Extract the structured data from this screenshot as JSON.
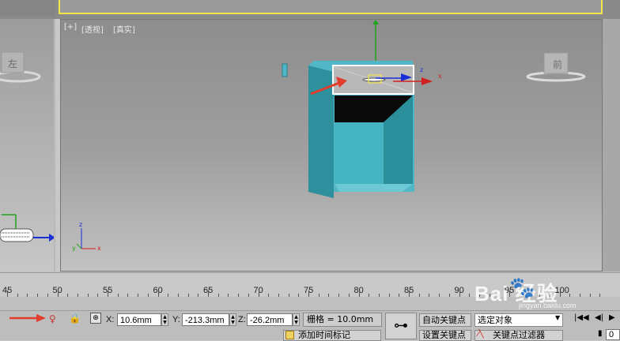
{
  "viewport": {
    "label_plus": "[+]",
    "label_view": "[透视]",
    "label_mode": "[真实]",
    "viewcube_left_face": "左",
    "viewcube_right_face": "前",
    "gizmo_x": "x",
    "gizmo_y": "y",
    "gizmo_z": "z"
  },
  "timeline": {
    "ticks": [
      "45",
      "50",
      "55",
      "60",
      "65",
      "70",
      "75",
      "80",
      "85",
      "90",
      "95",
      "100"
    ]
  },
  "status": {
    "x_label": "X:",
    "x_value": "10.6mm",
    "y_label": "Y:",
    "y_value": "-213.3mm",
    "z_label": "Z:",
    "z_value": "-26.2mm",
    "grid_text": "栅格 = 10.0mm",
    "auto_key": "自动关键点",
    "set_key": "设置关键点",
    "selected_object": "选定对象",
    "key_filters": "关键点过滤器",
    "add_time_tag": "添加时间标记",
    "frame_value": "0"
  },
  "watermark": {
    "text": "Bai 经验",
    "url": "jingyan.baidu.com"
  },
  "colors": {
    "cabinet": "#4fb7c6",
    "cabinet_dark": "#2b7d8a",
    "viewport_active_border": "#f0e64a",
    "axis_x": "#d22020",
    "axis_y": "#1fa31f",
    "axis_z": "#1a2ed8",
    "arrow": "#e23c2c"
  }
}
